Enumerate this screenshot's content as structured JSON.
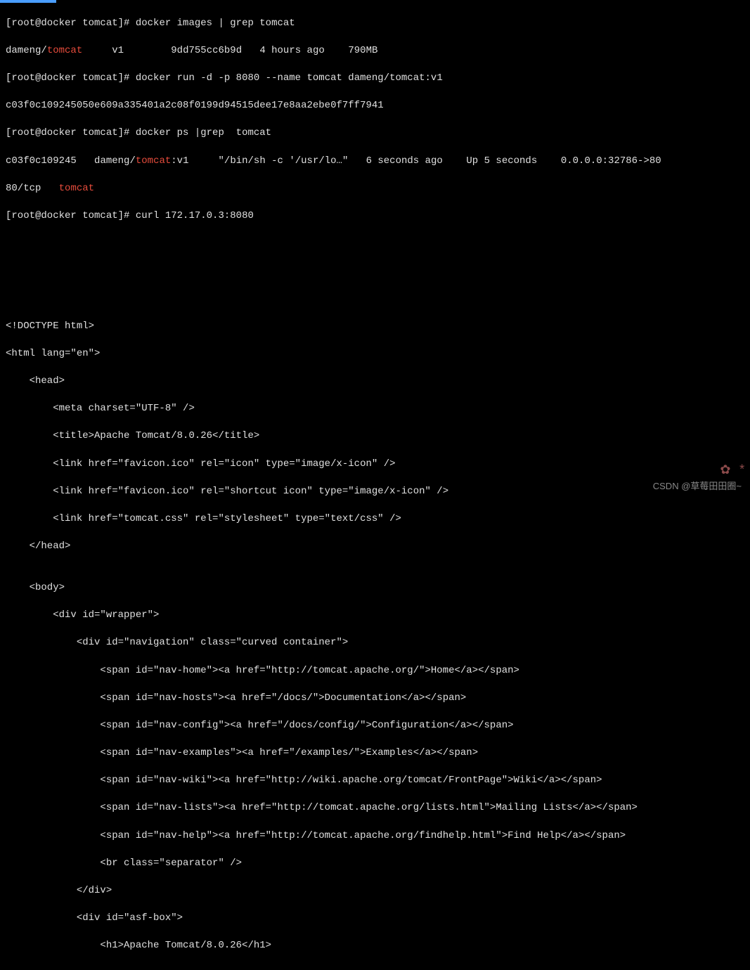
{
  "prompt": {
    "user": "root",
    "host": "docker",
    "path": "tomcat",
    "full": "[root@docker tomcat]#"
  },
  "cmd1": {
    "command": "docker images | grep tomcat",
    "out_repo_pre": "dameng/",
    "out_repo_hl": "tomcat",
    "out_tag": "v1",
    "out_id": "9dd755cc6b9d",
    "out_created": "4 hours ago",
    "out_size": "790MB"
  },
  "cmd2": {
    "command": "docker run -d -p 8080 --name tomcat dameng/tomcat:v1",
    "out_id": "c03f0c109245050e609a335401a2c08f0199d94515dee17e8aa2ebe0f7ff7941"
  },
  "cmd3": {
    "command": "docker ps |grep  tomcat",
    "out_id": "c03f0c109245",
    "out_img_pre": "dameng/",
    "out_img_hl": "tomcat",
    "out_img_suf": ":v1",
    "out_cmd": "\"/bin/sh -c '/usr/lo…\"",
    "out_created": "6 seconds ago",
    "out_status": "Up 5 seconds",
    "out_ports": "0.0.0.0:32786->80",
    "out_ports2": "80/tcp",
    "out_name": "tomcat"
  },
  "cmd4": {
    "command": "curl 172.17.0.3:8080"
  },
  "html_output": {
    "l01": "<!DOCTYPE html>",
    "l02": "<html lang=\"en\">",
    "l03": "    <head>",
    "l04": "        <meta charset=\"UTF-8\" />",
    "l05": "        <title>Apache Tomcat/8.0.26</title>",
    "l06": "        <link href=\"favicon.ico\" rel=\"icon\" type=\"image/x-icon\" />",
    "l07": "        <link href=\"favicon.ico\" rel=\"shortcut icon\" type=\"image/x-icon\" />",
    "l08": "        <link href=\"tomcat.css\" rel=\"stylesheet\" type=\"text/css\" />",
    "l09": "    </head>",
    "l10": "",
    "l11": "    <body>",
    "l12": "        <div id=\"wrapper\">",
    "l13": "            <div id=\"navigation\" class=\"curved container\">",
    "l14": "                <span id=\"nav-home\"><a href=\"http://tomcat.apache.org/\">Home</a></span>",
    "l15": "                <span id=\"nav-hosts\"><a href=\"/docs/\">Documentation</a></span>",
    "l16": "                <span id=\"nav-config\"><a href=\"/docs/config/\">Configuration</a></span>",
    "l17": "                <span id=\"nav-examples\"><a href=\"/examples/\">Examples</a></span>",
    "l18": "                <span id=\"nav-wiki\"><a href=\"http://wiki.apache.org/tomcat/FrontPage\">Wiki</a></span>",
    "l19": "                <span id=\"nav-lists\"><a href=\"http://tomcat.apache.org/lists.html\">Mailing Lists</a></span>",
    "l20": "                <span id=\"nav-help\"><a href=\"http://tomcat.apache.org/findhelp.html\">Find Help</a></span>",
    "l21": "                <br class=\"separator\" />",
    "l22": "            </div>",
    "l23": "            <div id=\"asf-box\">",
    "l24": "                <h1>Apache Tomcat/8.0.26</h1>"
  },
  "watermark": "CSDN @草莓田田圈~",
  "deco": "✿ *"
}
